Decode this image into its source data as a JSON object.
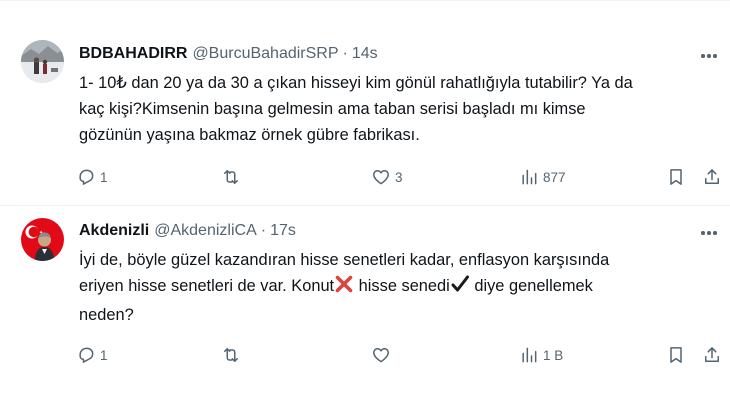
{
  "tweets": [
    {
      "author_name": "BDBAHADIRR",
      "handle": "@BurcuBahadirSRP",
      "separator": "·",
      "time": "14s",
      "lines": [
        "1- 10₺ dan 20 ya da 30 a çıkan hisseyi kim gönül rahatlığıyla tutabilir? Ya da",
        "kaç kişi?Kimsenin başına gelmesin ama taban serisi başladı mı kimse",
        "gözünün yaşına bakmaz örnek gübre fabrikası."
      ],
      "replies": "1",
      "retweets": "",
      "likes": "3",
      "views": "877"
    },
    {
      "author_name": "Akdenizli",
      "handle": "@AkdenizliCA",
      "separator": "·",
      "time": "17s",
      "line1": "İyi de, böyle güzel kazandıran hisse senetleri kadar, enflasyon karşısında",
      "line2_a": "eriyen hisse senetleri de var. Konut",
      "line2_b": " hisse senedi",
      "line2_c": "  diye genellemek",
      "line3": "neden?",
      "replies": "1",
      "retweets": "",
      "likes": "",
      "views": "1 B"
    }
  ],
  "icons": {
    "cross_mark": "cross-mark-emoji",
    "check_mark": "heavy-check-mark-emoji",
    "cross_color": "#e0443e",
    "check_color": "#1a1a1a"
  },
  "colors": {
    "text": "#0f1419",
    "secondary": "#536471",
    "divider": "#eff3f4"
  }
}
